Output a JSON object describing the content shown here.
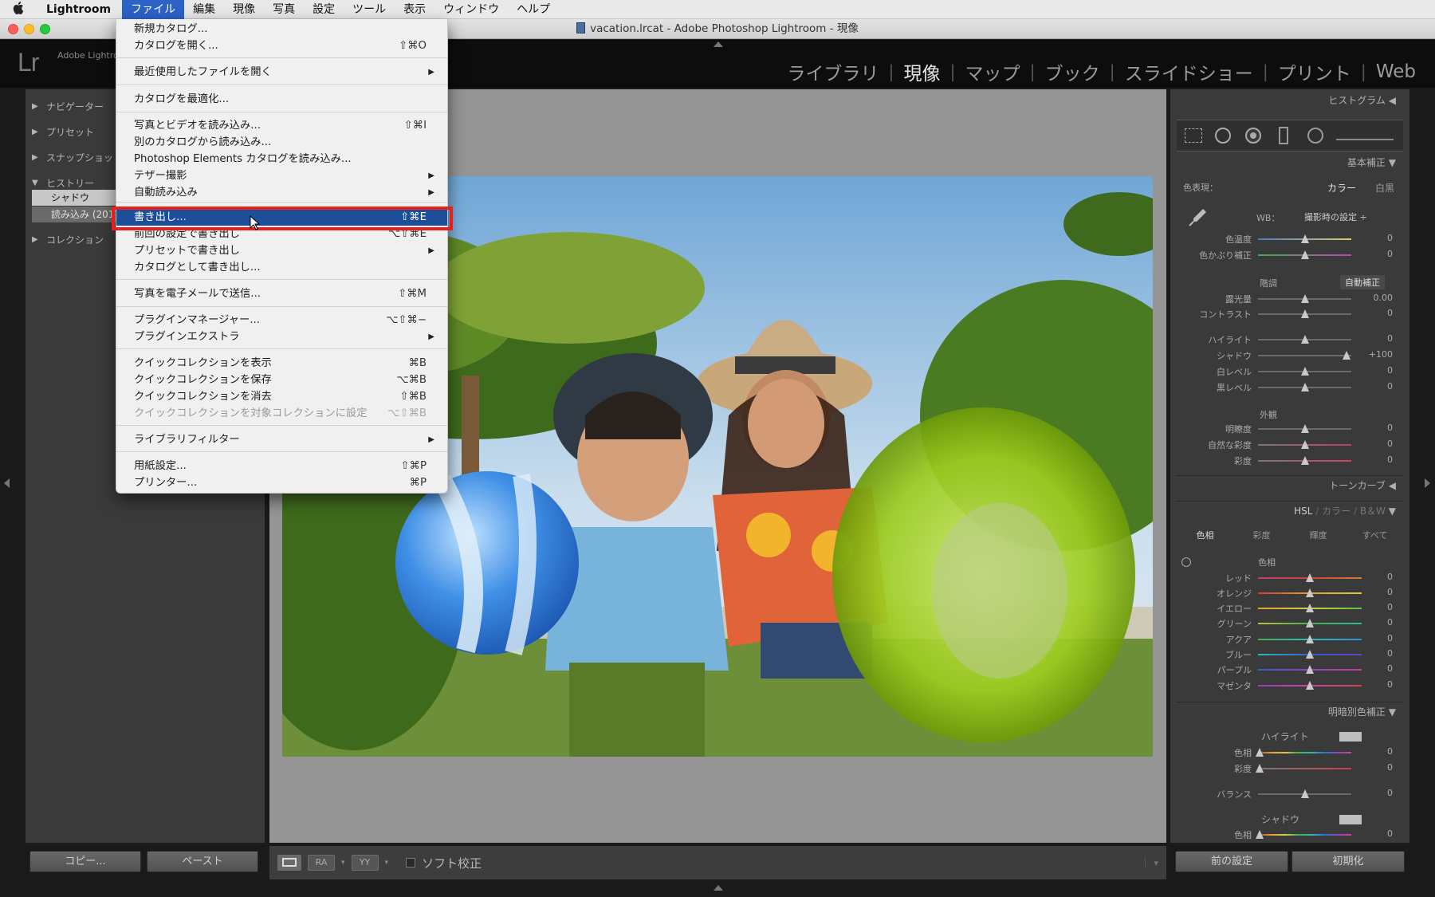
{
  "menubar": {
    "apple": "",
    "items": [
      "Lightroom",
      "ファイル",
      "編集",
      "現像",
      "写真",
      "設定",
      "ツール",
      "表示",
      "ウィンドウ",
      "ヘルプ"
    ]
  },
  "window": {
    "title": "vacation.lrcat - Adobe Photoshop Lightroom - 現像"
  },
  "header": {
    "logo": "Lr",
    "sub": "Adobe Lightro",
    "modules": [
      "ライブラリ",
      "現像",
      "マップ",
      "ブック",
      "スライドショー",
      "プリント",
      "Web"
    ],
    "active_module": "現像"
  },
  "left_panel": {
    "sections": [
      "ナビゲーター",
      "プリセット",
      "スナップショッ",
      "ヒストリー",
      "コレクション"
    ],
    "history": [
      "シャドウ",
      "読み込み (2017"
    ],
    "copy_button": "コピー...",
    "paste_button": "ペースト"
  },
  "toolbar": {
    "soft_proof": "ソフト校正",
    "ra": "RA",
    "yy": "YY"
  },
  "right_panel": {
    "histogram": "ヒストグラム",
    "basic": "基本補正",
    "treatment_label": "色表現：",
    "treatment_color": "カラー",
    "treatment_bw": "白黒",
    "wb_label": "WB：",
    "wb_value": "撮影時の設定 ÷",
    "tone": "階調",
    "auto": "自動補正",
    "presence": "外観",
    "tone_curve": "トーンカーブ",
    "hsl_header": {
      "hsl": "HSL",
      "color": "カラー",
      "bw": "B＆W"
    },
    "hsl_tabs": [
      "色相",
      "彩度",
      "輝度",
      "すべて"
    ],
    "hue_title": "色相",
    "split_toning": "明暗別色補正",
    "split_highlight": "ハイライト",
    "split_shadow": "シャドウ",
    "balance": "バランス",
    "prev_button": "前の設定",
    "reset_button": "初期化",
    "basic_sliders": [
      {
        "label": "色温度",
        "value": "0"
      },
      {
        "label": "色かぶり補正",
        "value": "0"
      },
      {
        "label": "露光量",
        "value": "0.00"
      },
      {
        "label": "コントラスト",
        "value": "0"
      },
      {
        "label": "ハイライト",
        "value": "0"
      },
      {
        "label": "シャドウ",
        "value": "+100"
      },
      {
        "label": "白レベル",
        "value": "0"
      },
      {
        "label": "黒レベル",
        "value": "0"
      },
      {
        "label": "明瞭度",
        "value": "0"
      },
      {
        "label": "自然な彩度",
        "value": "0"
      },
      {
        "label": "彩度",
        "value": "0"
      }
    ],
    "hue_sliders": [
      {
        "label": "レッド",
        "value": "0"
      },
      {
        "label": "オレンジ",
        "value": "0"
      },
      {
        "label": "イエロー",
        "value": "0"
      },
      {
        "label": "グリーン",
        "value": "0"
      },
      {
        "label": "アクア",
        "value": "0"
      },
      {
        "label": "ブルー",
        "value": "0"
      },
      {
        "label": "パープル",
        "value": "0"
      },
      {
        "label": "マゼンタ",
        "value": "0"
      }
    ],
    "split_sliders": [
      {
        "label": "色相",
        "value": "0"
      },
      {
        "label": "彩度",
        "value": "0"
      },
      {
        "label": "バランス",
        "value": "0"
      },
      {
        "label": "色相",
        "value": "0"
      }
    ]
  },
  "file_menu": {
    "items": [
      {
        "label": "新規カタログ...",
        "shortcut": ""
      },
      {
        "label": "カタログを開く...",
        "shortcut": "⇧⌘O"
      },
      {
        "label": "最近使用したファイルを開く",
        "shortcut": "",
        "submenu": true
      },
      {
        "label": "カタログを最適化...",
        "shortcut": ""
      },
      {
        "label": "写真とビデオを読み込み...",
        "shortcut": "⇧⌘I"
      },
      {
        "label": "別のカタログから読み込み...",
        "shortcut": ""
      },
      {
        "label": "Photoshop Elements カタログを読み込み...",
        "shortcut": ""
      },
      {
        "label": "テザー撮影",
        "shortcut": "",
        "submenu": true
      },
      {
        "label": "自動読み込み",
        "shortcut": "",
        "submenu": true
      },
      {
        "label": "書き出し...",
        "shortcut": "⇧⌘E",
        "highlighted": true
      },
      {
        "label": "前回の設定で書き出し",
        "shortcut": "⌥⇧⌘E"
      },
      {
        "label": "プリセットで書き出し",
        "shortcut": "",
        "submenu": true
      },
      {
        "label": "カタログとして書き出し...",
        "shortcut": ""
      },
      {
        "label": "写真を電子メールで送信...",
        "shortcut": "⇧⌘M"
      },
      {
        "label": "プラグインマネージャー...",
        "shortcut": "⌥⇧⌘−"
      },
      {
        "label": "プラグインエクストラ",
        "shortcut": "",
        "submenu": true
      },
      {
        "label": "クイックコレクションを表示",
        "shortcut": "⌘B"
      },
      {
        "label": "クイックコレクションを保存",
        "shortcut": "⌥⌘B"
      },
      {
        "label": "クイックコレクションを消去",
        "shortcut": "⇧⌘B"
      },
      {
        "label": "クイックコレクションを対象コレクションに設定",
        "shortcut": "⌥⇧⌘B",
        "disabled": true
      },
      {
        "label": "ライブラリフィルター",
        "shortcut": "",
        "submenu": true
      },
      {
        "label": "用紙設定...",
        "shortcut": "⇧⌘P"
      },
      {
        "label": "プリンター...",
        "shortcut": "⌘P"
      }
    ],
    "submenu_arrow": "▶"
  }
}
